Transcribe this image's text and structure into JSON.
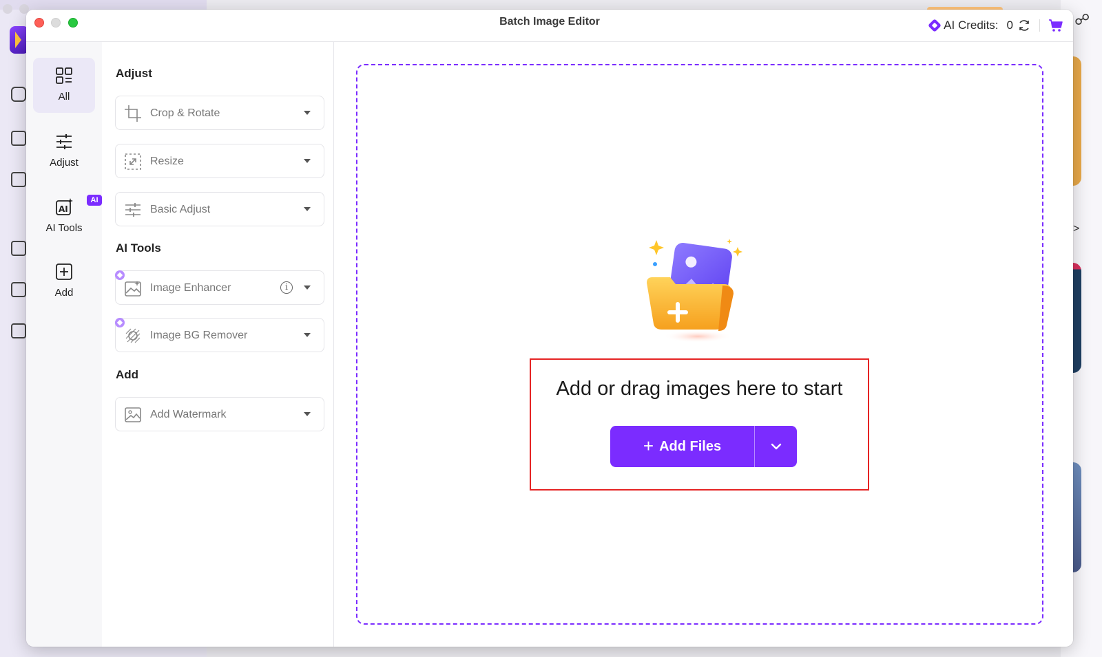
{
  "window": {
    "title": "Batch Image Editor"
  },
  "credits": {
    "label": "AI Credits:",
    "value": "0"
  },
  "nav": {
    "items": [
      {
        "label": "All",
        "icon": "grid-icon",
        "active": true
      },
      {
        "label": "Adjust",
        "icon": "sliders-icon"
      },
      {
        "label": "AI Tools",
        "icon": "ai-image-icon",
        "badge": "AI"
      },
      {
        "label": "Add",
        "icon": "plus-square-icon"
      }
    ]
  },
  "panel": {
    "sections": [
      {
        "title": "Adjust",
        "tools": [
          "Crop & Rotate",
          "Resize",
          "Basic Adjust"
        ]
      },
      {
        "title": "AI Tools",
        "tools": [
          "Image Enhancer",
          "Image BG Remover"
        ]
      },
      {
        "title": "Add",
        "tools": [
          "Add Watermark"
        ]
      }
    ]
  },
  "main": {
    "prompt": "Add or drag images here to start",
    "add_files_label": "Add Files"
  },
  "colors": {
    "accent": "#7b2cff",
    "highlight": "#e52323"
  }
}
